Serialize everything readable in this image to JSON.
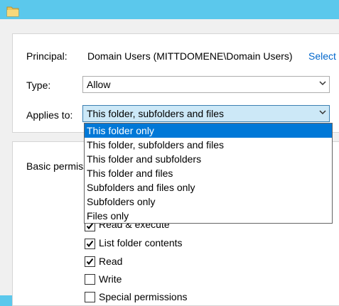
{
  "form": {
    "principal_label": "Principal:",
    "principal_value": "Domain Users (MITTDOMENE\\Domain Users)",
    "select_link": "Select",
    "type_label": "Type:",
    "type_value": "Allow",
    "applies_label": "Applies to:",
    "applies_value": "This folder, subfolders and files"
  },
  "dropdown": {
    "options": [
      "This folder only",
      "This folder, subfolders and files",
      "This folder and subfolders",
      "This folder and files",
      "Subfolders and files only",
      "Subfolders only",
      "Files only"
    ],
    "highlighted_index": 0
  },
  "permissions": {
    "heading": "Basic permissions:",
    "items": [
      {
        "label": "Read & execute",
        "checked": true
      },
      {
        "label": "List folder contents",
        "checked": true
      },
      {
        "label": "Read",
        "checked": true
      },
      {
        "label": "Write",
        "checked": false
      },
      {
        "label": "Special permissions",
        "checked": false
      }
    ]
  }
}
